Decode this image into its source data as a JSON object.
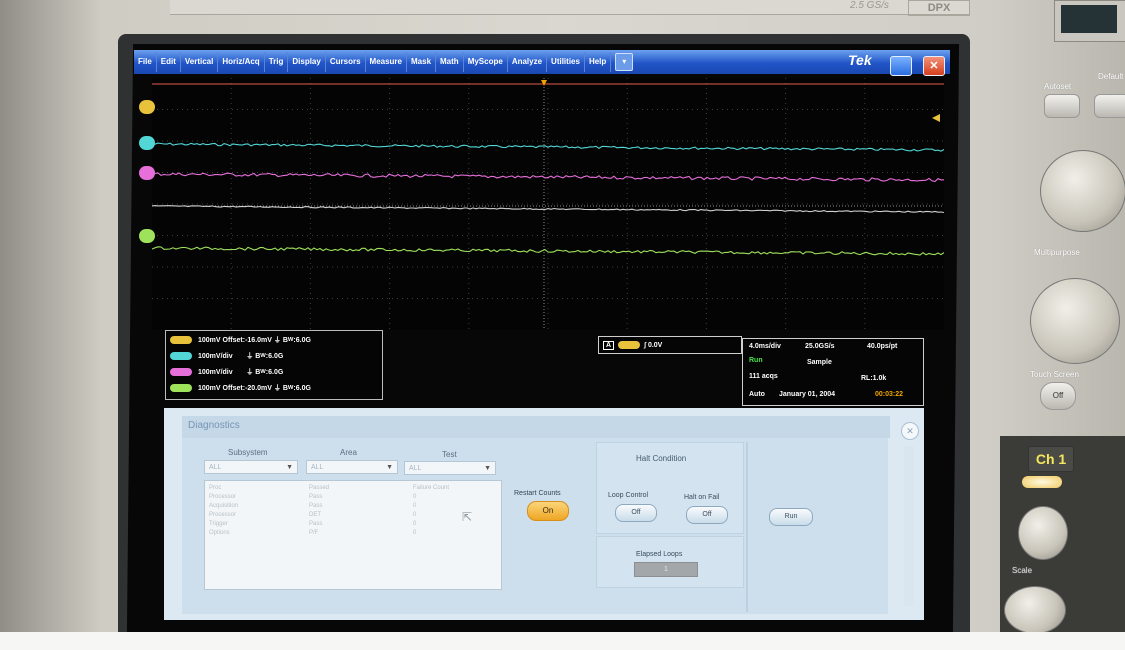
{
  "header": {
    "brand_series": "2.5 GS/s",
    "brand_model": "DPX"
  },
  "menu": {
    "items": [
      "File",
      "Edit",
      "Vertical",
      "Horiz/Acq",
      "Trig",
      "Display",
      "Cursors",
      "Measure",
      "Mask",
      "Math",
      "MyScope",
      "Analyze",
      "Utilities",
      "Help"
    ],
    "dropdown_icon": "chevron-down-icon",
    "logo": "Tek"
  },
  "colors": {
    "ch1": "#e8c23a",
    "ch2": "#52d6d6",
    "ch3": "#e66fd9",
    "ch4": "#9ee25b",
    "menubar": "#2155c8",
    "diag_bg": "#dce8f2"
  },
  "channels": [
    {
      "label": "100mV",
      "extra": "Offset:-16.0mV",
      "bw": "6.0G",
      "color": "#e8c23a"
    },
    {
      "label": "100mV/div",
      "extra": "",
      "bw": "6.0G",
      "color": "#52d6d6"
    },
    {
      "label": "100mV/div",
      "extra": "",
      "bw": "6.0G",
      "color": "#e66fd9"
    },
    {
      "label": "100mV",
      "extra": "Offset:-20.0mV",
      "bw": "6.0G",
      "color": "#9ee25b"
    }
  ],
  "trigger": {
    "source": "A",
    "level": "0.0V"
  },
  "acquisition": {
    "timebase": "4.0ms/div",
    "sample_rate": "25.0GS/s",
    "resolution": "40.0ps/pt",
    "state": "Run",
    "mode": "Sample",
    "count": "111 acqs",
    "record_length": "RL:1.0k",
    "trigger_mode": "Auto",
    "date": "January 01, 2004",
    "time": "00:03:22"
  },
  "diagnostics": {
    "title": "Diagnostics",
    "columns": [
      "Subsystem",
      "Area",
      "Test"
    ],
    "dropdowns": [
      "ALL",
      "ALL",
      "ALL"
    ],
    "results_rows": [
      {
        "subsystem": "Proc",
        "status": "Passed",
        "failures": "Failure Count"
      },
      {
        "subsystem": "Processor",
        "status": "Pass",
        "failures": "0"
      },
      {
        "subsystem": "Acquisition",
        "status": "Pass",
        "failures": "0"
      },
      {
        "subsystem": "Processor",
        "status": "DET",
        "failures": "0"
      },
      {
        "subsystem": "Trigger",
        "status": "Pass",
        "failures": "0"
      },
      {
        "subsystem": "Options",
        "status": "P/F",
        "failures": "0"
      }
    ],
    "restart_counts_label": "Restart Counts",
    "restart_counts_value": "On",
    "halt_condition_title": "Halt Condition",
    "loop_control_label": "Loop Control",
    "loop_control_value": "Off",
    "halt_on_fail_label": "Halt on Fail",
    "halt_on_fail_value": "Off",
    "elapsed_loops_label": "Elapsed Loops",
    "elapsed_loops_value": "1",
    "run_label": "Run",
    "close_icon": "close-icon"
  },
  "panel": {
    "autoset": "Autoset",
    "default_setup": "Default Setup",
    "multipurpose": "Multipurpose",
    "fine_label": "Fine",
    "touch_screen": "Touch Screen",
    "touch_screen_state": "Off",
    "ch1": "Ch 1",
    "scale": "Scale"
  }
}
